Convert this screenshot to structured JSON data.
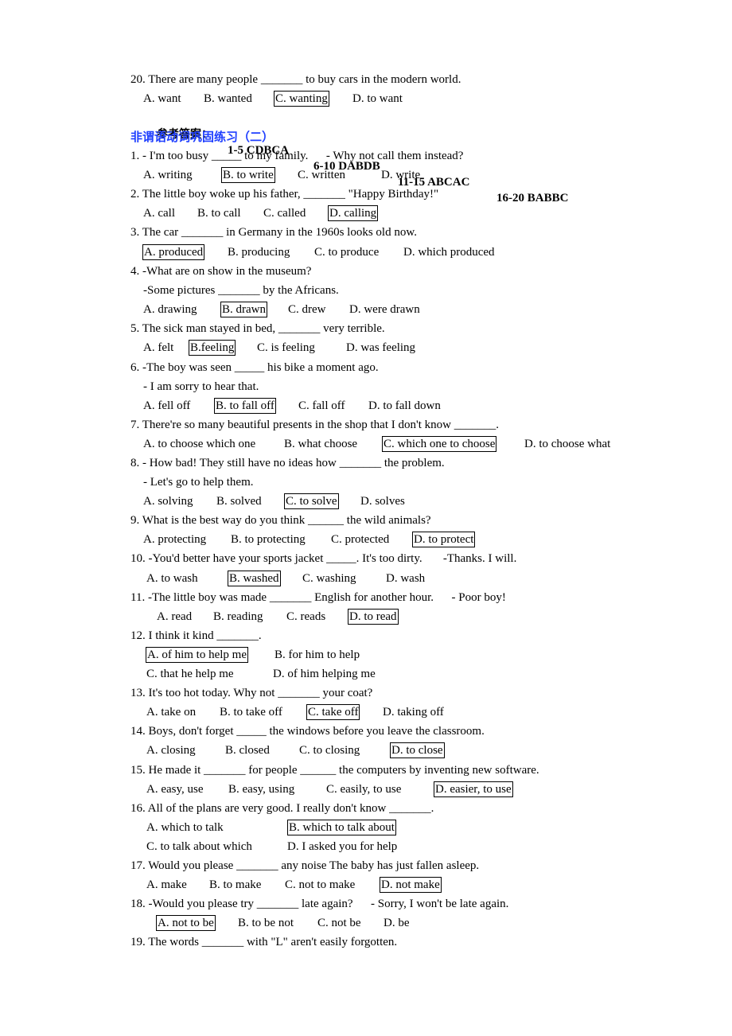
{
  "prev_question": {
    "stem": "20. There are many people _______ to buy cars in the modern world.",
    "options": [
      "A. want",
      "B. wanted",
      "C. wanting",
      "D. to want"
    ],
    "correct": 2
  },
  "answer_key": {
    "label": "参考答案：",
    "groups": [
      "1-5 CDBCA",
      "6-10 DABDB",
      "11-15 ABCAC",
      "16-20 BABBC"
    ]
  },
  "section_title": "非谓语动词巩固练习（二）",
  "questions": [
    {
      "lines": [
        "1. - I'm too busy _____ to my family.      - Why not call them instead?"
      ],
      "option_rows": [
        [
          "A. writing",
          "B. to write",
          "C. written",
          "D. write"
        ]
      ],
      "correct": "B. to write"
    },
    {
      "lines": [
        "2. The little boy woke up his father, _______ \"Happy Birthday!\""
      ],
      "option_rows": [
        [
          "A. call",
          "B. to call",
          "C. called",
          "D. calling"
        ]
      ],
      "correct": "D. calling"
    },
    {
      "lines": [
        "3. The car _______ in Germany in the 1960s looks old now."
      ],
      "option_rows": [
        [
          "A. produced",
          "B. producing",
          "C. to produce",
          "D. which produced"
        ]
      ],
      "correct": "A. produced"
    },
    {
      "lines": [
        "4. -What are on show in the museum?",
        "-Some pictures _______ by the Africans."
      ],
      "option_rows": [
        [
          "A. drawing",
          "B. drawn",
          "C. drew",
          "D. were drawn"
        ]
      ],
      "correct": "B. drawn"
    },
    {
      "lines": [
        "5. The sick man stayed in bed, _______ very terrible."
      ],
      "option_rows": [
        [
          "A. felt",
          "B.feeling",
          "C. is feeling",
          "D. was feeling"
        ]
      ],
      "correct": "B.feeling"
    },
    {
      "lines": [
        "6. -The boy was seen _____ his bike a moment ago.",
        "- I am sorry to hear that."
      ],
      "option_rows": [
        [
          "A. fell off",
          "B. to fall off",
          "C. fall off",
          "D. to fall down"
        ]
      ],
      "correct": "B. to fall off"
    },
    {
      "lines": [
        "7. There're so many beautiful presents in the shop that I don't know _______."
      ],
      "option_rows": [
        [
          "A. to choose which one",
          "B. what choose",
          "C. which one to choose",
          "D. to choose what"
        ]
      ],
      "correct": "C. which one to choose"
    },
    {
      "lines": [
        "8. - How bad! They still have no ideas how _______ the problem.",
        "- Let's go to help them."
      ],
      "option_rows": [
        [
          "A. solving",
          "B. solved",
          "C. to solve",
          "D. solves"
        ]
      ],
      "correct": "C. to solve"
    },
    {
      "lines": [
        "9. What is the best way do you think ______ the wild animals?"
      ],
      "option_rows": [
        [
          "A. protecting",
          "B. to protecting",
          "C. protected",
          "D. to protect"
        ]
      ],
      "correct": "D. to protect"
    },
    {
      "lines": [
        "10. -You'd better have your sports jacket _____. It's too dirty.       -Thanks. I will."
      ],
      "option_rows": [
        [
          "A. to wash",
          "B. washed",
          "C. washing",
          "D. wash"
        ]
      ],
      "correct": "B. washed"
    },
    {
      "lines": [
        "11. -The little boy was made _______ English for another hour.      - Poor boy!"
      ],
      "option_rows": [
        [
          "A. read",
          "B. reading",
          "C. reads",
          "D. to read"
        ]
      ],
      "correct": "D. to read"
    },
    {
      "lines": [
        "12. I think it kind _______."
      ],
      "option_rows": [
        [
          "A. of him to help me",
          "B. for him to help"
        ],
        [
          "C. that he help me",
          "D. of him helping me"
        ]
      ],
      "correct": "A. of him to help me"
    },
    {
      "lines": [
        "13. It's too hot today. Why not _______ your coat?"
      ],
      "option_rows": [
        [
          "A. take on",
          "B. to take off",
          "C. take off",
          "D. taking off"
        ]
      ],
      "correct": "C. take off"
    },
    {
      "lines": [
        "14. Boys, don't forget _____ the windows before you leave the classroom."
      ],
      "option_rows": [
        [
          "A. closing",
          "B. closed",
          "C. to closing",
          "D. to close"
        ]
      ],
      "correct": "D. to close"
    },
    {
      "lines": [
        "15. He made it _______ for people ______ the computers by inventing new software."
      ],
      "option_rows": [
        [
          "A. easy, use",
          "B. easy, using",
          "C. easily, to use",
          "D. easier, to use"
        ]
      ],
      "correct": "D. easier, to use"
    },
    {
      "lines": [
        "16. All of the plans are very good. I really don't know _______."
      ],
      "option_rows": [
        [
          "A. which to talk",
          "B. which to talk about"
        ],
        [
          "C. to talk about which",
          "D. I asked you for help"
        ]
      ],
      "correct": "B. which to talk about"
    },
    {
      "lines": [
        "17. Would you please _______ any noise The baby has just fallen asleep."
      ],
      "option_rows": [
        [
          "A. make",
          "B. to make",
          "C. not to make",
          "D. not make"
        ]
      ],
      "correct": "D. not make"
    },
    {
      "lines": [
        "18. -Would you please try _______ late again?      - Sorry, I won't be late again."
      ],
      "option_rows": [
        [
          "A. not to be",
          "B. to be not",
          "C. not be",
          "D. be"
        ]
      ],
      "correct": "A. not to be"
    },
    {
      "lines": [
        "19. The words _______ with \"L\" aren't easily forgotten."
      ],
      "option_rows": [],
      "correct": ""
    }
  ]
}
